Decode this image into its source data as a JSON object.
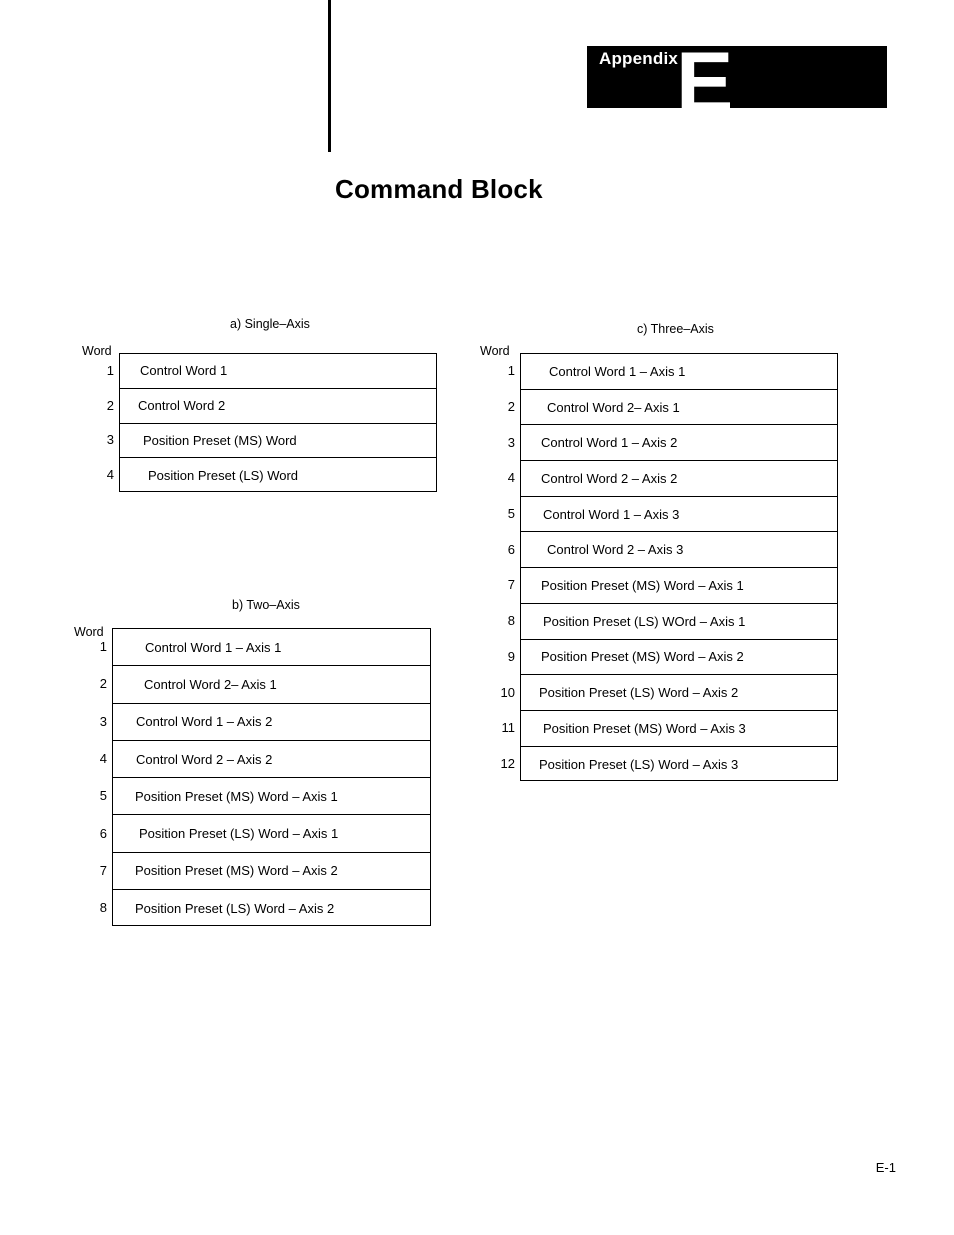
{
  "header": {
    "appendix_label": "Appendix",
    "appendix_letter": "E"
  },
  "page_title": "Command Block",
  "footer": {
    "page_number": "E-1"
  },
  "figures": [
    {
      "caption": "a) Single–Axis",
      "word_header": "Word",
      "rows": [
        {
          "num": "1",
          "text": "Control Word 1",
          "indent": 20
        },
        {
          "num": "2",
          "text": "Control Word 2",
          "indent": 18
        },
        {
          "num": "3",
          "text": "Position Preset (MS) Word",
          "indent": 23
        },
        {
          "num": "4",
          "text": "Position Preset (LS) Word",
          "indent": 28
        }
      ]
    },
    {
      "caption": "b) Two–Axis",
      "word_header": "Word",
      "rows": [
        {
          "num": "1",
          "text": "Control Word 1 – Axis 1",
          "indent": 32
        },
        {
          "num": "2",
          "text": "Control Word 2– Axis 1",
          "indent": 31
        },
        {
          "num": "3",
          "text": "Control Word 1 – Axis 2",
          "indent": 23
        },
        {
          "num": "4",
          "text": "Control Word 2 – Axis 2",
          "indent": 23
        },
        {
          "num": "5",
          "text": "Position Preset (MS) Word – Axis 1",
          "indent": 22
        },
        {
          "num": "6",
          "text": "Position Preset (LS) Word – Axis 1",
          "indent": 26
        },
        {
          "num": "7",
          "text": "Position Preset (MS) Word – Axis 2",
          "indent": 22
        },
        {
          "num": "8",
          "text": "Position Preset (LS) Word – Axis 2",
          "indent": 22
        }
      ]
    },
    {
      "caption": "c) Three–Axis",
      "word_header": "Word",
      "rows": [
        {
          "num": "1",
          "text": "Control Word 1 – Axis 1",
          "indent": 28
        },
        {
          "num": "2",
          "text": "Control Word 2– Axis 1",
          "indent": 26
        },
        {
          "num": "3",
          "text": "Control Word 1 – Axis 2",
          "indent": 20
        },
        {
          "num": "4",
          "text": "Control Word 2 – Axis 2",
          "indent": 20
        },
        {
          "num": "5",
          "text": "Control Word 1 – Axis 3",
          "indent": 22
        },
        {
          "num": "6",
          "text": "Control Word 2 – Axis 3",
          "indent": 26
        },
        {
          "num": "7",
          "text": "Position Preset (MS) Word – Axis 1",
          "indent": 20
        },
        {
          "num": "8",
          "text": "Position Preset (LS) WOrd – Axis 1",
          "indent": 22
        },
        {
          "num": "9",
          "text": "Position Preset (MS) Word – Axis 2",
          "indent": 20
        },
        {
          "num": "10",
          "text": "Position Preset (LS) Word – Axis 2",
          "indent": 18
        },
        {
          "num": "11",
          "text": "Position Preset (MS) Word – Axis 3",
          "indent": 22
        },
        {
          "num": "12",
          "text": "Position Preset (LS) Word – Axis 3",
          "indent": 18
        }
      ]
    }
  ]
}
